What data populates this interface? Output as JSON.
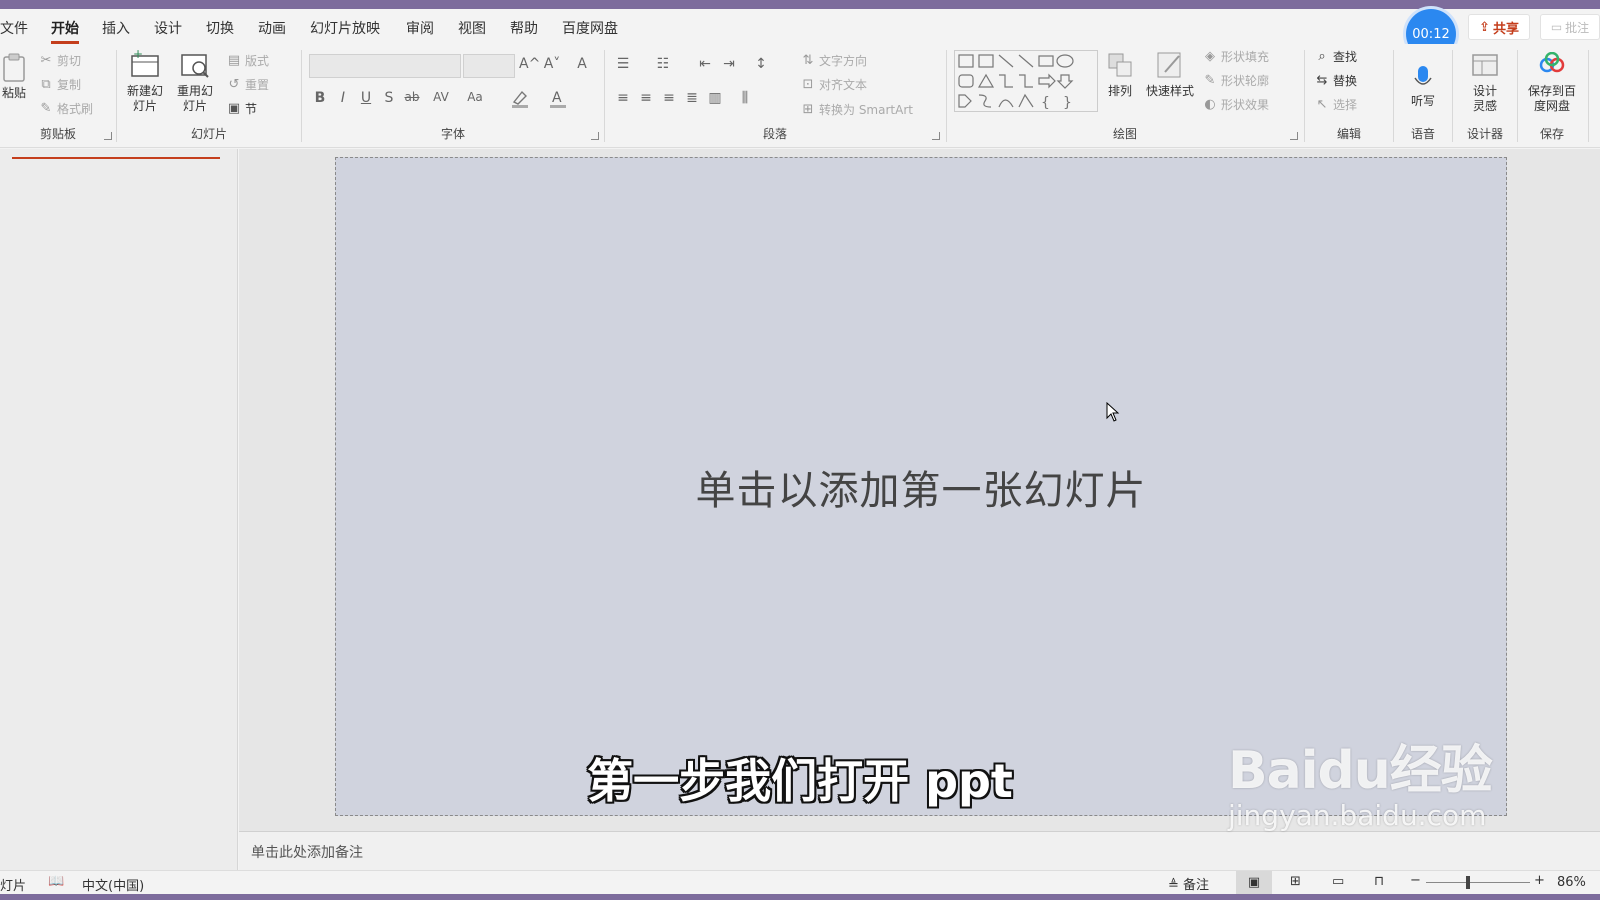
{
  "tabs": [
    {
      "label": "文件"
    },
    {
      "label": "开始"
    },
    {
      "label": "插入"
    },
    {
      "label": "设计"
    },
    {
      "label": "切换"
    },
    {
      "label": "动画"
    },
    {
      "label": "幻灯片放映"
    },
    {
      "label": "审阅"
    },
    {
      "label": "视图"
    },
    {
      "label": "帮助"
    },
    {
      "label": "百度网盘"
    }
  ],
  "timer": "00:12",
  "share_label": "共享",
  "comment_label": "批注",
  "clipboard": {
    "paste": "粘贴",
    "cut": "剪切",
    "copy": "复制",
    "format_painter": "格式刷",
    "label": "剪贴板"
  },
  "slides": {
    "new": "新建幻灯片",
    "reuse": "重用幻灯片",
    "layout": "版式",
    "reset": "重置",
    "section": "节",
    "label": "幻灯片"
  },
  "font": {
    "grow": "A^",
    "shrink": "A˅",
    "clear": "A",
    "bold": "B",
    "italic": "I",
    "underline": "U",
    "shadow": "S",
    "strike": "ab",
    "spacing": "AV",
    "case": "Aa",
    "label": "字体"
  },
  "paragraph": {
    "text_direction": "文字方向",
    "align_text": "对齐文本",
    "smartart": "转换为 SmartArt",
    "label": "段落"
  },
  "drawing": {
    "arrange": "排列",
    "quick_styles": "快速样式",
    "fill": "形状填充",
    "outline": "形状轮廓",
    "effects": "形状效果",
    "label": "绘图"
  },
  "editing": {
    "find": "查找",
    "replace": "替换",
    "select": "选择",
    "label": "编辑"
  },
  "voice": {
    "dictate": "听写",
    "label": "语音"
  },
  "designer": {
    "design_ideas": "设计灵感",
    "label": "设计器"
  },
  "save": {
    "save_baidu": "保存到百度网盘",
    "label": "保存"
  },
  "slide_placeholder": "单击以添加第一张幻灯片",
  "subtitle": "第一步我们打开 ppt",
  "notes_placeholder": "单击此处添加备注",
  "status": {
    "slide_label": "灯片",
    "language": "中文(中国)",
    "notes_button": "备注",
    "zoom": "86%"
  },
  "watermark": {
    "logo": "Baidu经验",
    "url": "jingyan.baidu.com"
  },
  "colors": {
    "accent": "#c43e1c",
    "slide_bg": "#d0d3de",
    "stripe": "#7d6c9c",
    "timer": "#2b88f0"
  }
}
